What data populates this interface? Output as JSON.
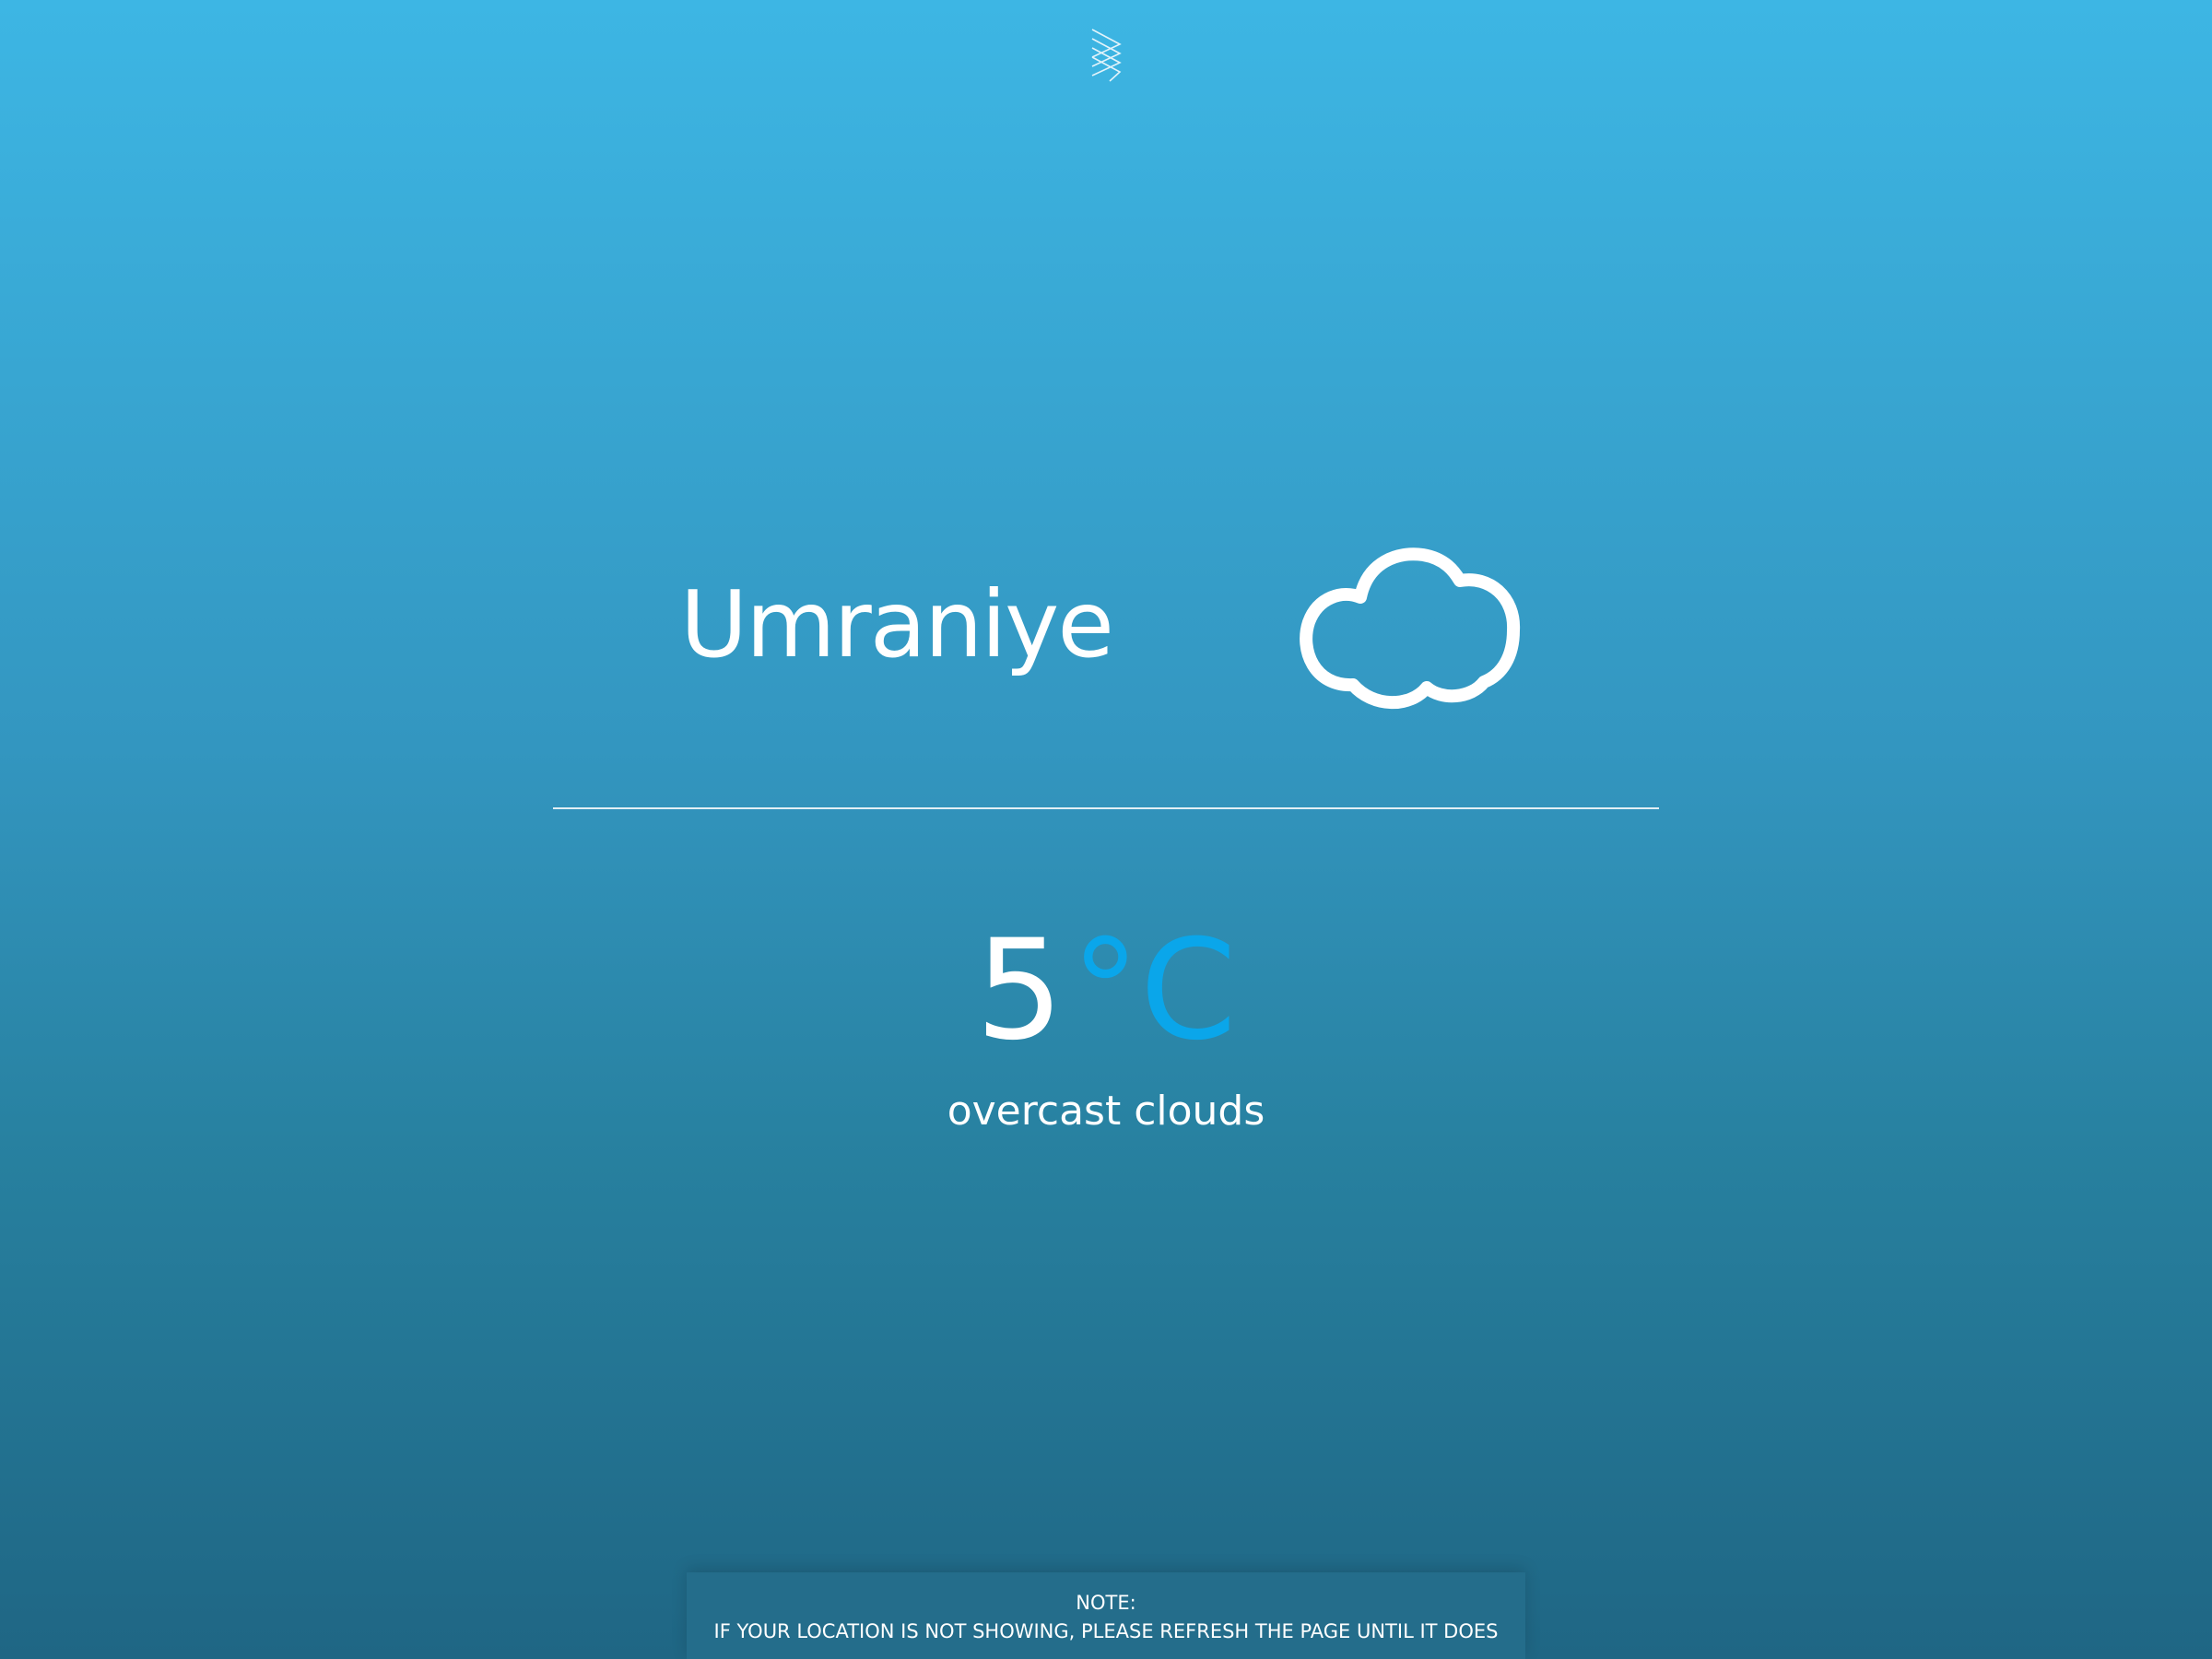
{
  "header": {
    "logo_icon": "chevron-stack-logo-icon"
  },
  "weather": {
    "city": "Umraniye",
    "icon": "cloud-icon",
    "temperature": "5",
    "unit": "°C",
    "description": "overcast clouds"
  },
  "note": {
    "title": "NOTE:",
    "message": "IF YOUR LOCATION IS NOT SHOWING, PLEASE REFRESH THE PAGE UNTIL IT DOES"
  },
  "colors": {
    "background_top": "#3db6e4",
    "background_bottom": "#1f6684",
    "accent_unit": "#0aa6ea",
    "note_background": "#246d8b",
    "text": "#ffffff"
  }
}
